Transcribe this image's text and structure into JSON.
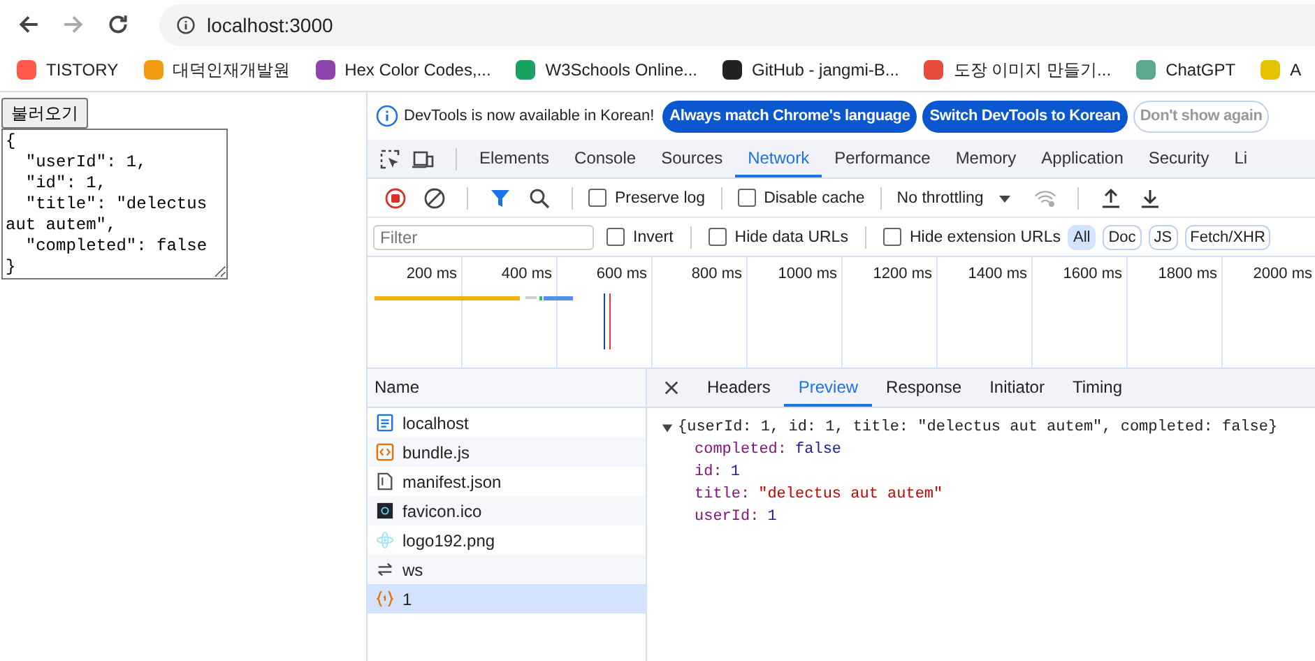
{
  "browser": {
    "address": "localhost:3000",
    "bookmarks": [
      {
        "label": "TISTORY"
      },
      {
        "label": "대덕인재개발원"
      },
      {
        "label": "Hex Color Codes,..."
      },
      {
        "label": "W3Schools Online..."
      },
      {
        "label": "GitHub - jangmi-B..."
      },
      {
        "label": "도장 이미지 만들기..."
      },
      {
        "label": "ChatGPT"
      },
      {
        "label": "A"
      }
    ]
  },
  "page": {
    "button_label": "불러오기",
    "textarea_value": "{\n  \"userId\": 1,\n  \"id\": 1,\n  \"title\": \"delectus aut autem\",\n  \"completed\": false\n}"
  },
  "devtools": {
    "info_bar": {
      "message": "DevTools is now available in Korean!",
      "buttons": [
        {
          "label": "Always match Chrome's language",
          "kind": "primary"
        },
        {
          "label": "Switch DevTools to Korean",
          "kind": "primary"
        },
        {
          "label": "Don't show again",
          "kind": "outline"
        }
      ]
    },
    "tabs": [
      {
        "label": "Elements",
        "selected": false
      },
      {
        "label": "Console",
        "selected": false
      },
      {
        "label": "Sources",
        "selected": false
      },
      {
        "label": "Network",
        "selected": true
      },
      {
        "label": "Performance",
        "selected": false
      },
      {
        "label": "Memory",
        "selected": false
      },
      {
        "label": "Application",
        "selected": false
      },
      {
        "label": "Security",
        "selected": false
      },
      {
        "label": "Li",
        "selected": false
      }
    ],
    "toolbar": {
      "checkboxes": [
        {
          "label": "Preserve log",
          "checked": false
        },
        {
          "label": "Disable cache",
          "checked": false
        }
      ],
      "throttling": "No throttling"
    },
    "filter": {
      "placeholder": "Filter",
      "checkboxes": [
        {
          "label": "Invert",
          "checked": false
        },
        {
          "label": "Hide data URLs",
          "checked": false
        },
        {
          "label": "Hide extension URLs",
          "checked": false
        }
      ],
      "types": [
        {
          "label": "All",
          "selected": true
        },
        {
          "label": "Doc",
          "selected": false
        },
        {
          "label": "JS",
          "selected": false
        },
        {
          "label": "Fetch/XHR",
          "selected": false
        }
      ]
    },
    "timeline_ticks": [
      "200 ms",
      "400 ms",
      "600 ms",
      "800 ms",
      "1000 ms",
      "1200 ms",
      "1400 ms",
      "1600 ms",
      "1800 ms",
      "2000 ms"
    ],
    "requests": {
      "column": "Name",
      "rows": [
        {
          "name": "localhost",
          "kind": "document",
          "selected": false
        },
        {
          "name": "bundle.js",
          "kind": "script",
          "selected": false
        },
        {
          "name": "manifest.json",
          "kind": "file",
          "selected": false
        },
        {
          "name": "favicon.ico",
          "kind": "image",
          "selected": false
        },
        {
          "name": "logo192.png",
          "kind": "logo",
          "selected": false
        },
        {
          "name": "ws",
          "kind": "socket",
          "selected": false
        },
        {
          "name": "1",
          "kind": "fetch",
          "selected": true
        }
      ]
    },
    "detail_tabs": [
      {
        "label": "Headers",
        "selected": false
      },
      {
        "label": "Preview",
        "selected": true
      },
      {
        "label": "Response",
        "selected": false
      },
      {
        "label": "Initiator",
        "selected": false
      },
      {
        "label": "Timing",
        "selected": false
      }
    ],
    "preview": {
      "expanded": true,
      "summary": "{userId: 1, id: 1, title: \"delectus aut autem\", completed: false}",
      "properties": [
        {
          "key": "completed:",
          "value": "false",
          "kind": "boolean"
        },
        {
          "key": "id:",
          "value": "1",
          "kind": "number"
        },
        {
          "key": "title:",
          "value": "\"delectus aut autem\"",
          "kind": "string"
        },
        {
          "key": "userId:",
          "value": "1",
          "kind": "number"
        }
      ]
    }
  }
}
